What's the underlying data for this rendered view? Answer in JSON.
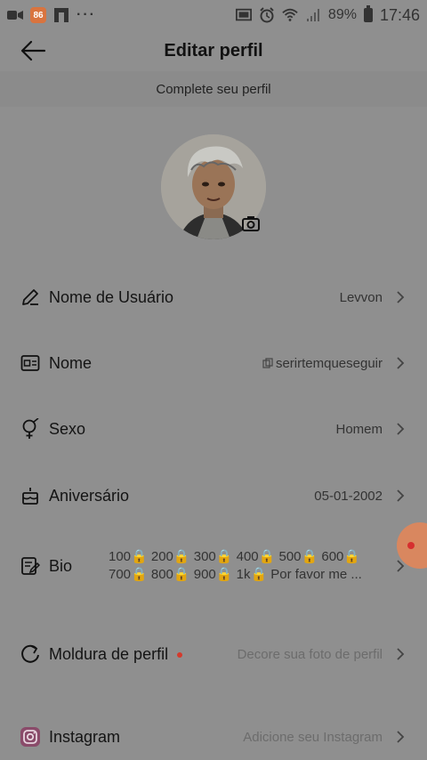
{
  "status_bar": {
    "app_badge_text": "86",
    "more_text": "···",
    "battery_text": "89%",
    "time": "17:46"
  },
  "header": {
    "title": "Editar perfil",
    "subtitle": "Complete seu perfil"
  },
  "profile_rows": [
    {
      "label": "Nome de Usuário",
      "value": "Levvon",
      "icon": "edit-pencil-icon"
    },
    {
      "label": "Nome",
      "value": "serirtemqueseguir",
      "icon": "id-card-icon"
    },
    {
      "label": "Sexo",
      "value": "Homem",
      "icon": "gender-icon"
    },
    {
      "label": "Aniversário",
      "value": "05-01-2002",
      "icon": "cake-icon"
    }
  ],
  "bio": {
    "label": "Bio",
    "line1": "100🔒 200🔒 300🔒 400🔒 500🔒 600🔒",
    "line2": "700🔒 800🔒 900🔒 1k🔒 Por favor me ..."
  },
  "frame_row": {
    "label": "Moldura de perfil",
    "value": "Decore sua foto de perfil"
  },
  "instagram_row": {
    "label": "Instagram",
    "value": "Adicione seu Instagram"
  },
  "colors": {
    "overlay_background": "#8f8f8f",
    "accent_orange": "#d9875f",
    "red_dot": "#d43a2c"
  }
}
